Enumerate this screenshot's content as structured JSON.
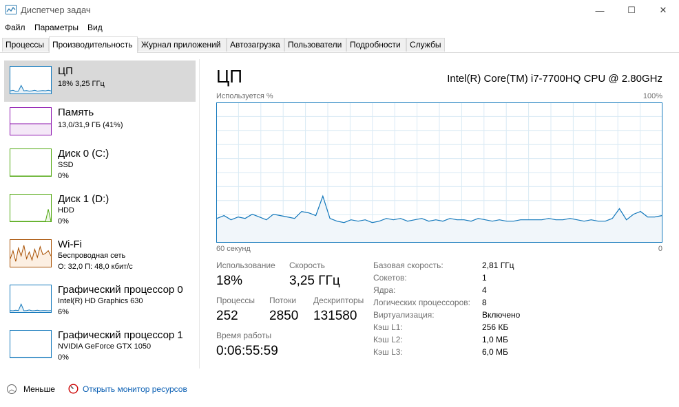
{
  "window": {
    "title": "Диспетчер задач",
    "controls": {
      "minimize": "—",
      "maximize": "☐",
      "close": "✕"
    }
  },
  "menu": [
    "Файл",
    "Параметры",
    "Вид"
  ],
  "tabs": [
    "Процессы",
    "Производительность",
    "Журнал приложений",
    "Автозагрузка",
    "Пользователи",
    "Подробности",
    "Службы"
  ],
  "active_tab": "Производительность",
  "sidebar": [
    {
      "title": "ЦП",
      "sub1": "18% 3,25 ГГц",
      "sub2": "",
      "sub3": "",
      "color": "#1177bb",
      "active": true
    },
    {
      "title": "Память",
      "sub1": "13,0/31,9 ГБ (41%)",
      "sub2": "",
      "sub3": "",
      "color": "#8b12ae",
      "active": false
    },
    {
      "title": "Диск 0 (C:)",
      "sub1": "SSD",
      "sub2": "0%",
      "sub3": "",
      "color": "#4da60c",
      "active": false
    },
    {
      "title": "Диск 1 (D:)",
      "sub1": "HDD",
      "sub2": "0%",
      "sub3": "",
      "color": "#4da60c",
      "active": false
    },
    {
      "title": "Wi-Fi",
      "sub1": "Беспроводная сеть",
      "sub2": "О: 32,0  П: 48,0 кбит/с",
      "sub3": "",
      "color": "#a74f01",
      "active": false
    },
    {
      "title": "Графический процессор 0",
      "sub1": "Intel(R) HD Graphics 630",
      "sub2": "6%",
      "sub3": "",
      "color": "#1177bb",
      "active": false
    },
    {
      "title": "Графический процессор 1",
      "sub1": "NVIDIA GeForce GTX 1050",
      "sub2": "0%",
      "sub3": "",
      "color": "#1177bb",
      "active": false
    }
  ],
  "main": {
    "title": "ЦП",
    "cpu_name": "Intel(R) Core(TM) i7-7700HQ CPU @ 2.80GHz",
    "graph_label": "Используется %",
    "graph_max": "100%",
    "graph_time": "60 секунд",
    "graph_zero": "0",
    "stats": {
      "usage_label": "Использование",
      "usage": "18%",
      "speed_label": "Скорость",
      "speed": "3,25 ГГц",
      "processes_label": "Процессы",
      "processes": "252",
      "threads_label": "Потоки",
      "threads": "2850",
      "handles_label": "Дескрипторы",
      "handles": "131580",
      "uptime_label": "Время работы",
      "uptime": "0:06:55:59"
    },
    "specs": [
      {
        "label": "Базовая скорость:",
        "value": "2,81 ГГц"
      },
      {
        "label": "Сокетов:",
        "value": "1"
      },
      {
        "label": "Ядра:",
        "value": "4"
      },
      {
        "label": "Логических процессоров:",
        "value": "8"
      },
      {
        "label": "Виртуализация:",
        "value": "Включено"
      },
      {
        "label": "Кэш L1:",
        "value": "256 КБ"
      },
      {
        "label": "Кэш L2:",
        "value": "1,0 МБ"
      },
      {
        "label": "Кэш L3:",
        "value": "6,0 МБ"
      }
    ]
  },
  "footer": {
    "fewer": "Меньше",
    "resource_monitor": "Открыть монитор ресурсов"
  },
  "chart_data": {
    "type": "area",
    "ylim": [
      0,
      100
    ],
    "xlim": [
      60,
      0
    ],
    "color": "#1177bb",
    "values": [
      17,
      19,
      16,
      18,
      17,
      20,
      18,
      16,
      20,
      19,
      18,
      17,
      22,
      21,
      19,
      33,
      17,
      15,
      14,
      16,
      15,
      16,
      14,
      15,
      17,
      16,
      17,
      15,
      16,
      17,
      15,
      16,
      15,
      17,
      16,
      16,
      15,
      17,
      16,
      15,
      16,
      15,
      15,
      16,
      16,
      16,
      16,
      17,
      16,
      16,
      17,
      16,
      15,
      16,
      15,
      15,
      17,
      24,
      16,
      20,
      22,
      18,
      18,
      19
    ],
    "series_thumbs": {
      "cpu": [
        10,
        12,
        8,
        9,
        30,
        10,
        11,
        9,
        10,
        12,
        9,
        10,
        11,
        10,
        12,
        10
      ],
      "mem": [
        41,
        41,
        41,
        41,
        41,
        41,
        41,
        41,
        41,
        41,
        41,
        41,
        41,
        41,
        41,
        41
      ],
      "disk0": [
        0,
        0,
        0,
        0,
        0,
        0,
        0,
        0,
        0,
        0,
        0,
        0,
        0,
        0,
        0,
        0
      ],
      "disk1": [
        0,
        0,
        0,
        0,
        0,
        0,
        0,
        0,
        0,
        0,
        0,
        0,
        0,
        0,
        45,
        0
      ],
      "wifi": [
        30,
        60,
        20,
        70,
        40,
        80,
        30,
        55,
        25,
        65,
        35,
        75,
        45,
        50,
        60,
        40
      ],
      "gpu0": [
        6,
        5,
        7,
        6,
        30,
        5,
        6,
        8,
        5,
        6,
        7,
        5,
        6,
        6,
        5,
        6
      ],
      "gpu1": [
        0,
        0,
        0,
        0,
        0,
        0,
        0,
        0,
        0,
        0,
        0,
        0,
        0,
        0,
        0,
        0
      ]
    }
  }
}
